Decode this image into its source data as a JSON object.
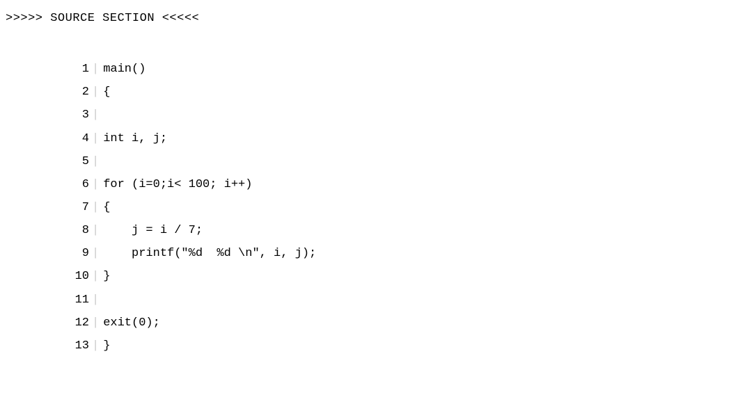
{
  "header": ">>>>> SOURCE SECTION <<<<<",
  "separator": "|",
  "lines": [
    {
      "num": "1",
      "code": "main()"
    },
    {
      "num": "2",
      "code": "{"
    },
    {
      "num": "3",
      "code": ""
    },
    {
      "num": "4",
      "code": "int i, j;"
    },
    {
      "num": "5",
      "code": ""
    },
    {
      "num": "6",
      "code": "for (i=0;i< 100; i++)"
    },
    {
      "num": "7",
      "code": "{"
    },
    {
      "num": "8",
      "code": "    j = i / 7;"
    },
    {
      "num": "9",
      "code": "    printf(\"%d  %d \\n\", i, j);"
    },
    {
      "num": "10",
      "code": "}"
    },
    {
      "num": "11",
      "code": ""
    },
    {
      "num": "12",
      "code": "exit(0);"
    },
    {
      "num": "13",
      "code": "}"
    }
  ]
}
